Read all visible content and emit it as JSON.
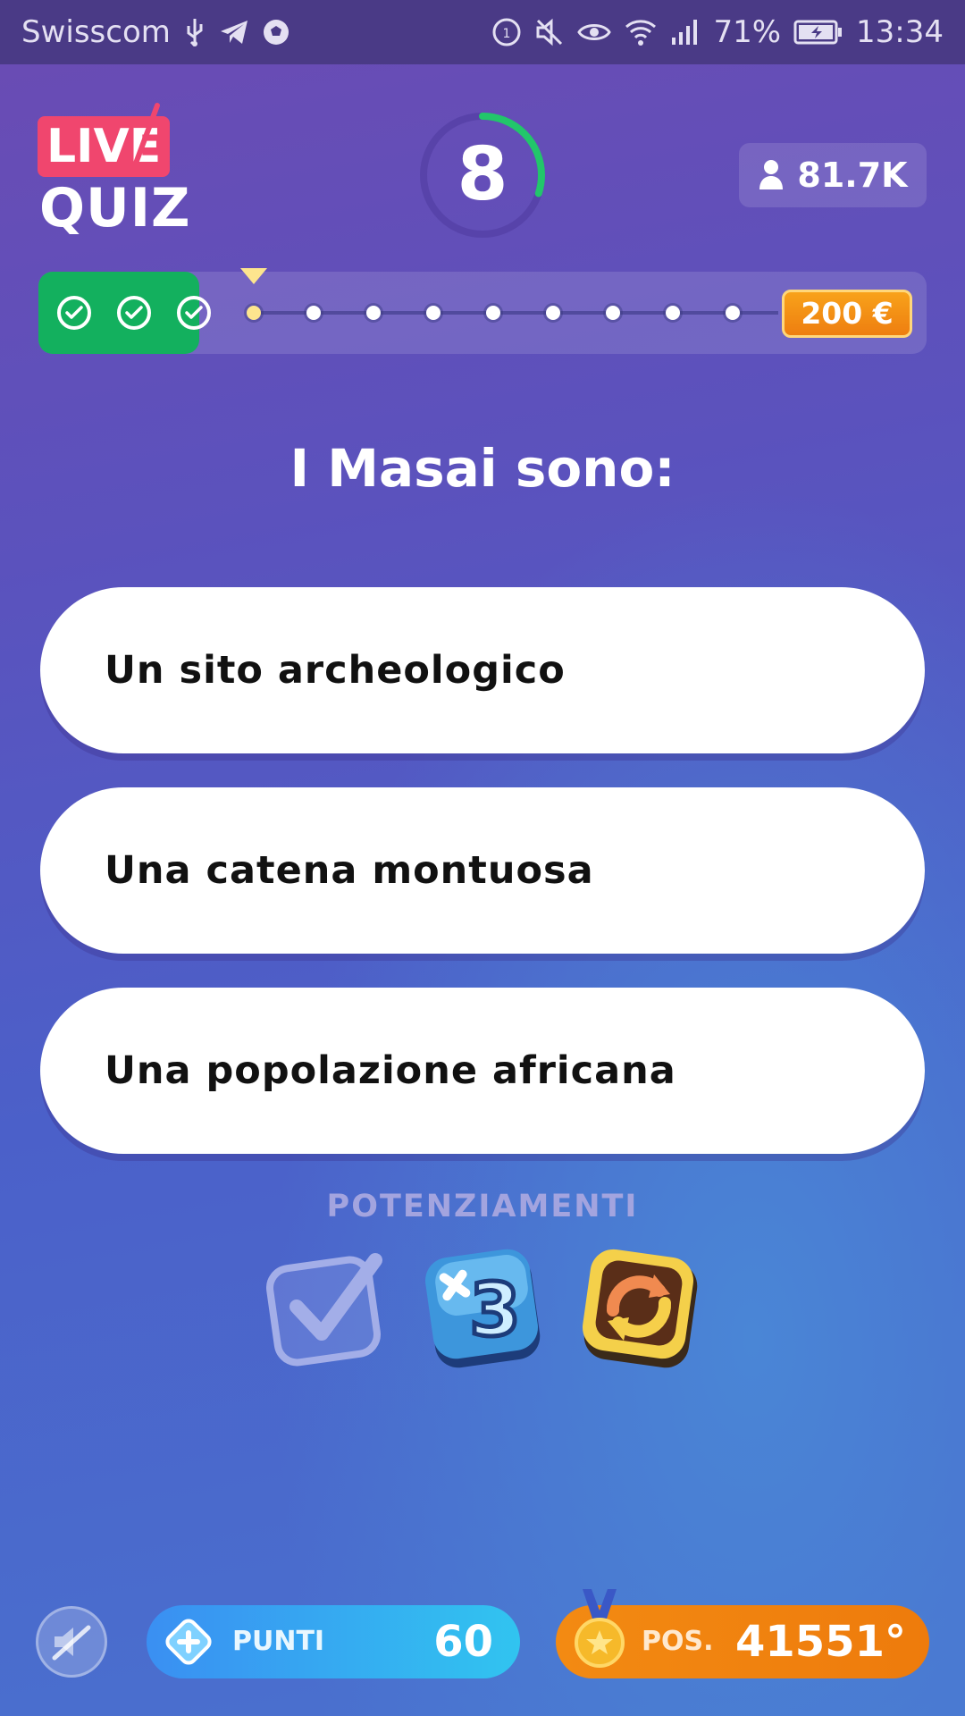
{
  "status_bar": {
    "carrier": "Swisscom",
    "battery": "71%",
    "time": "13:34",
    "icons": [
      "usb-icon",
      "telegram-icon",
      "soccer-ball-icon",
      "data-saver-icon",
      "mute-icon",
      "eye-icon",
      "wifi-icon",
      "signal-icon",
      "battery-icon"
    ]
  },
  "header": {
    "logo_live": "LIVE",
    "logo_quiz": "QUIZ",
    "timer": "8",
    "timer_fraction": 0.3,
    "viewers": "81.7K"
  },
  "progress": {
    "completed": 3,
    "total_steps": 12,
    "current_step": 4,
    "prize": "200 €"
  },
  "question": "I Masai sono:",
  "answers": [
    "Un sito archeologico",
    "Una catena montuosa",
    "Una popolazione africana"
  ],
  "powerups": {
    "label": "POTENZIAMENTI",
    "items": [
      "check-powerup-icon",
      "plus-three-powerup-icon",
      "refresh-powerup-icon"
    ]
  },
  "footer": {
    "points_label": "PUNTI",
    "points_value": "60",
    "position_label": "POS.",
    "position_value": "41551°"
  },
  "colors": {
    "accent_green": "#13b05e",
    "live_pink": "#f0466e",
    "prize_orange": "#f39a18",
    "points_blue": "#3a8ff2",
    "position_orange": "#f38a12"
  }
}
